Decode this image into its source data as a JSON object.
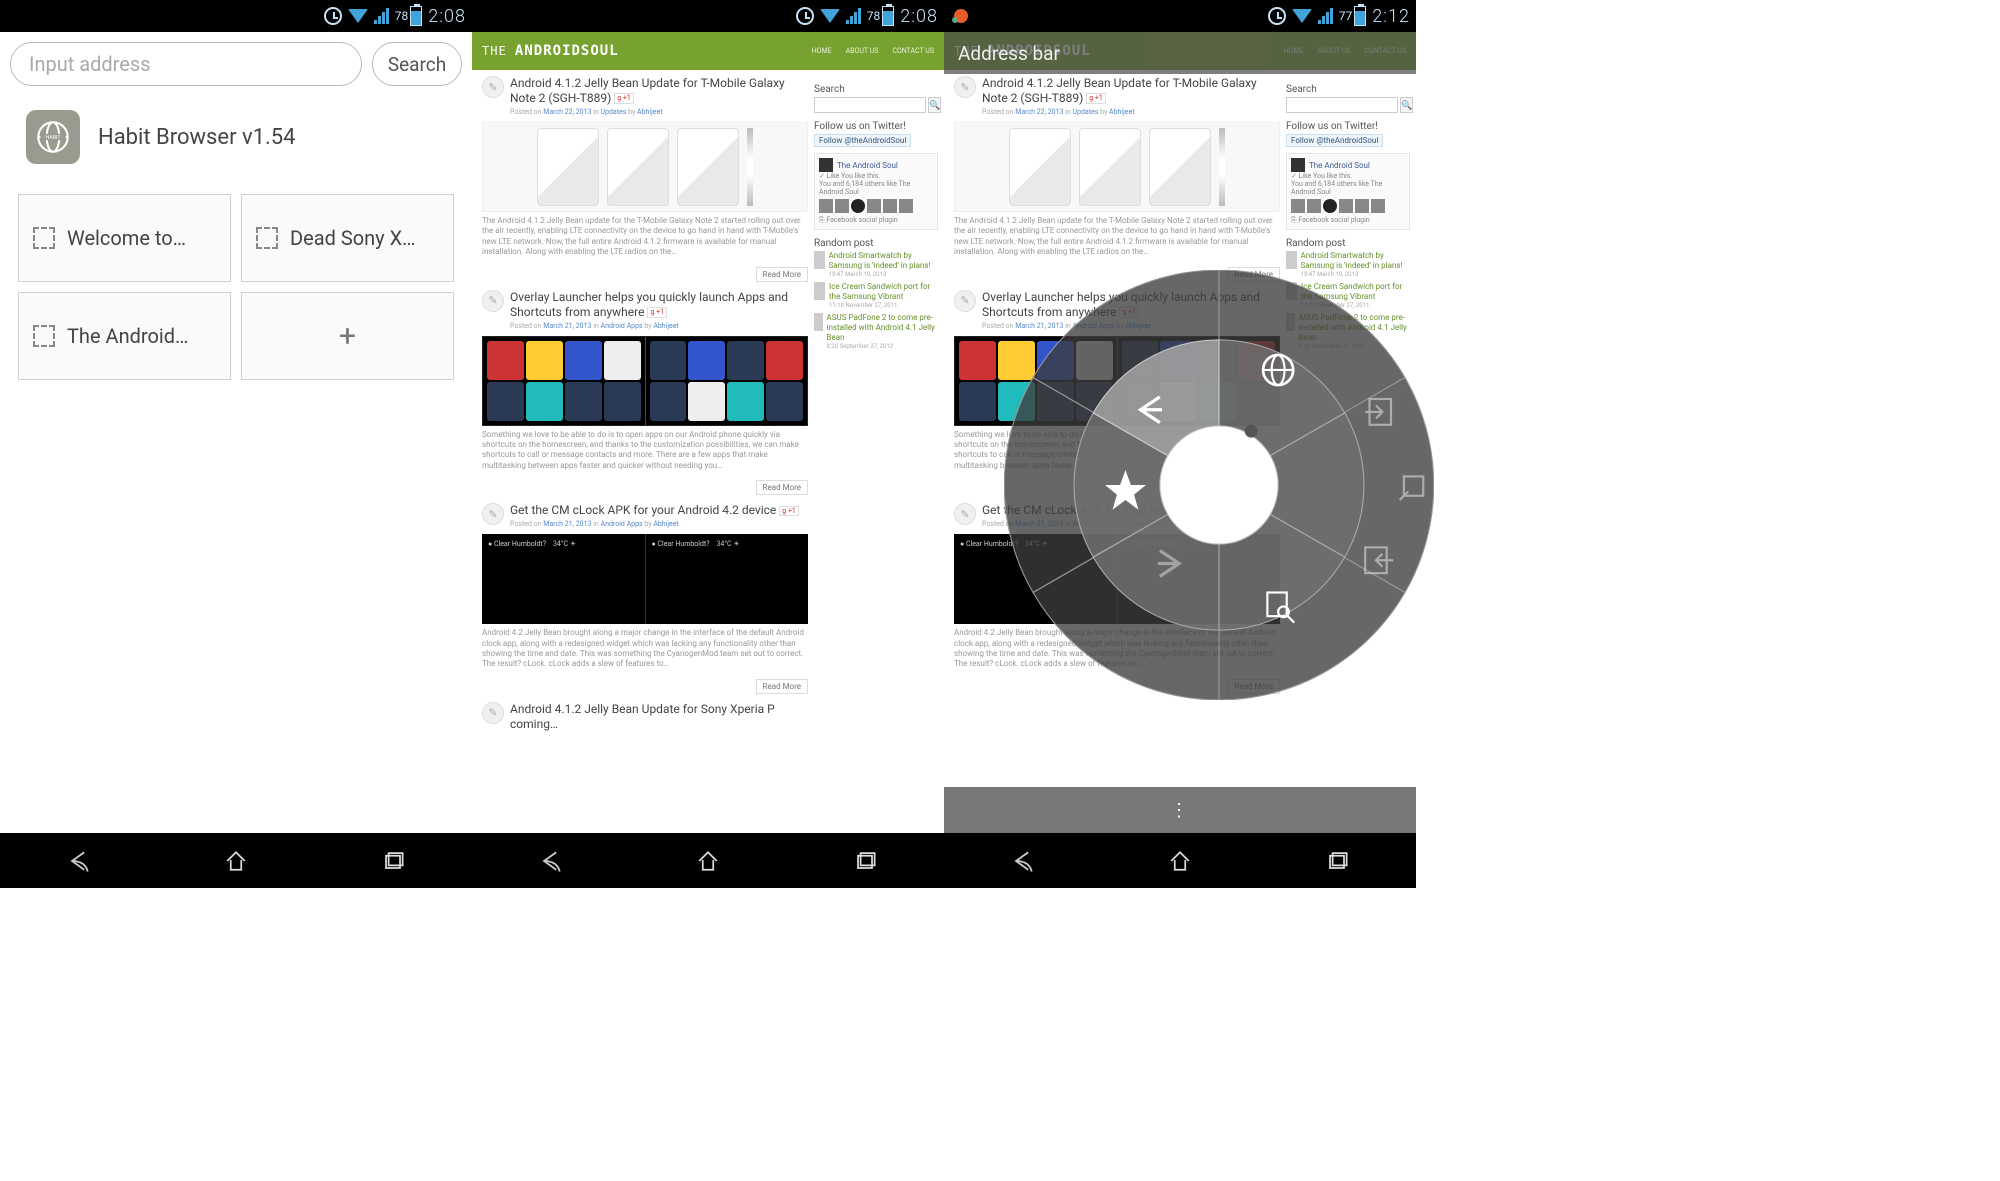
{
  "status": {
    "batteryA": "78",
    "batteryB": "78",
    "batteryC": "77",
    "timeA": "2:08",
    "timeB": "2:08",
    "timeC": "2:12"
  },
  "panel1": {
    "addr_placeholder": "Input address",
    "search_label": "Search",
    "app_name": "Habit Browser v1.54",
    "tiles": [
      "Welcome to…",
      "Dead Sony X…",
      "The Android…"
    ]
  },
  "panel3": {
    "addr_label": "Address bar"
  },
  "site": {
    "logo_pre": "THE",
    "logo_main": "ANDROIDSOUL",
    "nav": [
      "HOME",
      "ABOUT US",
      "CONTACT US"
    ],
    "search_h": "Search",
    "twitter_h": "Follow us on Twitter!",
    "twitter_btn": "Follow @theAndroidSoul",
    "fb_title": "The Android Soul",
    "fb_like": "✓ Like   You like this.",
    "fb_sub": "You and 6,184 others like The Android Soul",
    "fb_share": "⎘ Facebook social plugin",
    "random_h": "Random post",
    "random": [
      {
        "t": "Android Smartwatch by Samsung is 'indeed' in plans!",
        "d": "19:47 March 19, 2013"
      },
      {
        "t": "Ice Cream Sandwich port for the Samsung Vibrant",
        "d": "11:10 November 27, 2011"
      },
      {
        "t": "ASUS PadFone 2 to come pre-installed with Android 4.1 Jelly Bean",
        "d": "8:20 September 27, 2012"
      }
    ],
    "posts": [
      {
        "title": "Android 4.1.2 Jelly Bean Update for T-Mobile Galaxy Note 2 (SGH-T889)",
        "meta_pre": "Posted on ",
        "meta_date": "March 22, 2013",
        "meta_mid": " in ",
        "meta_cat": "Updates",
        "meta_by": " by ",
        "meta_author": "Abhijeet",
        "excerpt": "The Android 4.1.2 Jelly Bean update for the T-Mobile Galaxy Note 2 started rolling out over the air recently, enabling LTE connectivity on the device to go hand in hand with T-Mobile's new LTE network. Now, the full entire Android 4.1.2 firmware is available for manual installation. Along with enabling the LTE radios on the…",
        "read_more": "Read More"
      },
      {
        "title": "Overlay Launcher helps you quickly launch Apps and Shortcuts from anywhere",
        "meta_pre": "Posted on ",
        "meta_date": "March 21, 2013",
        "meta_mid": " in ",
        "meta_cat": "Android Apps",
        "meta_by": " by ",
        "meta_author": "Abhijeet",
        "excerpt": "Something we love to be able to do is to open apps on our Android phone quickly via shortcuts on the homescreen, and thanks to the customization possibilities, we can make shortcuts to call or message contacts and more. There are a few apps that make multitasking between apps faster and quicker without needing you…",
        "read_more": "Read More"
      },
      {
        "title": "Get the CM cLock APK for your Android 4.2 device",
        "meta_pre": "Posted on ",
        "meta_date": "March 21, 2013",
        "meta_mid": " in ",
        "meta_cat": "Android Apps",
        "meta_by": " by ",
        "meta_author": "Abhijeet",
        "excerpt": "Android 4.2 Jelly Bean brought along a major change in the interface of the default Android clock app, along with a redesigned widget which was lacking any functionality other than showing the time and date. This was something the CyanogenMod team set out to correct. The result? cLock. cLock adds a slew of features to…",
        "read_more": "Read More"
      },
      {
        "title_trunc": "Android 4.1.2 Jelly Bean Update for Sony Xperia P coming…"
      }
    ]
  },
  "g_badge": "g +1"
}
